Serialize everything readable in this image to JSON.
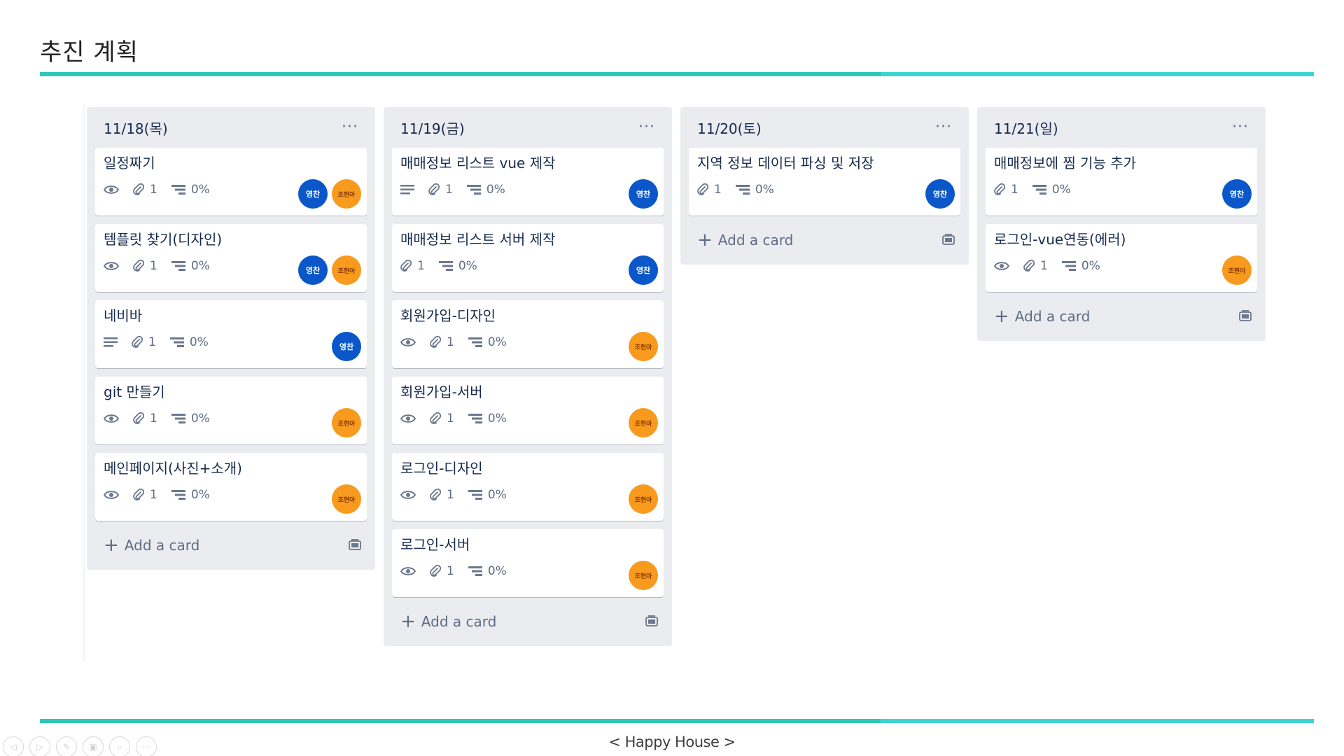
{
  "slide": {
    "title": "추진 계획",
    "footer": "< Happy House >",
    "controls": [
      "◁",
      "▷",
      "✎",
      "▣",
      "⌕",
      "⋯"
    ]
  },
  "colors": {
    "accent_rule": "#2ec7b8",
    "list_bg": "#ebecf0",
    "avatar_blue": "#0b57c9",
    "avatar_orange": "#f79a1d"
  },
  "icons": {
    "watch": "eye-icon",
    "description": "description-icon",
    "attachment": "paperclip-icon",
    "checklist": "checklist-icon",
    "menu": "ellipsis-icon",
    "add": "plus-icon",
    "template": "card-template-icon"
  },
  "board": {
    "add_card_label": "Add a card",
    "menu_label": "···",
    "lists": [
      {
        "title": "11/18(목)",
        "cards": [
          {
            "title": "일정짜기",
            "attachments": "1",
            "progress": "0%"
          },
          {
            "title": "템플릿 찾기(디자인)",
            "attachments": "1",
            "progress": "0%"
          },
          {
            "title": "네비바",
            "attachments": "1",
            "progress": "0%"
          },
          {
            "title": "git 만들기",
            "attachments": "1",
            "progress": "0%"
          },
          {
            "title": "메인페이지(사진+소개)",
            "attachments": "1",
            "progress": "0%"
          }
        ]
      },
      {
        "title": "11/19(금)",
        "cards": [
          {
            "title": "매매정보 리스트 vue 제작",
            "attachments": "1",
            "progress": "0%"
          },
          {
            "title": "매매정보 리스트 서버 제작",
            "attachments": "1",
            "progress": "0%"
          },
          {
            "title": "회원가입-디자인",
            "attachments": "1",
            "progress": "0%"
          },
          {
            "title": "회원가입-서버",
            "attachments": "1",
            "progress": "0%"
          },
          {
            "title": "로그인-디자인",
            "attachments": "1",
            "progress": "0%"
          },
          {
            "title": "로그인-서버",
            "attachments": "1",
            "progress": "0%"
          }
        ]
      },
      {
        "title": "11/20(토)",
        "cards": [
          {
            "title": "지역 정보 데이터 파싱 및 저장",
            "attachments": "1",
            "progress": "0%"
          }
        ]
      },
      {
        "title": "11/21(일)",
        "cards": [
          {
            "title": "매매정보에 찜 기능 추가",
            "attachments": "1",
            "progress": "0%"
          },
          {
            "title": "로그인-vue연동(에러)",
            "attachments": "1",
            "progress": "0%"
          }
        ]
      }
    ]
  },
  "members": {
    "blue": "영찬",
    "orange": "조현아"
  }
}
